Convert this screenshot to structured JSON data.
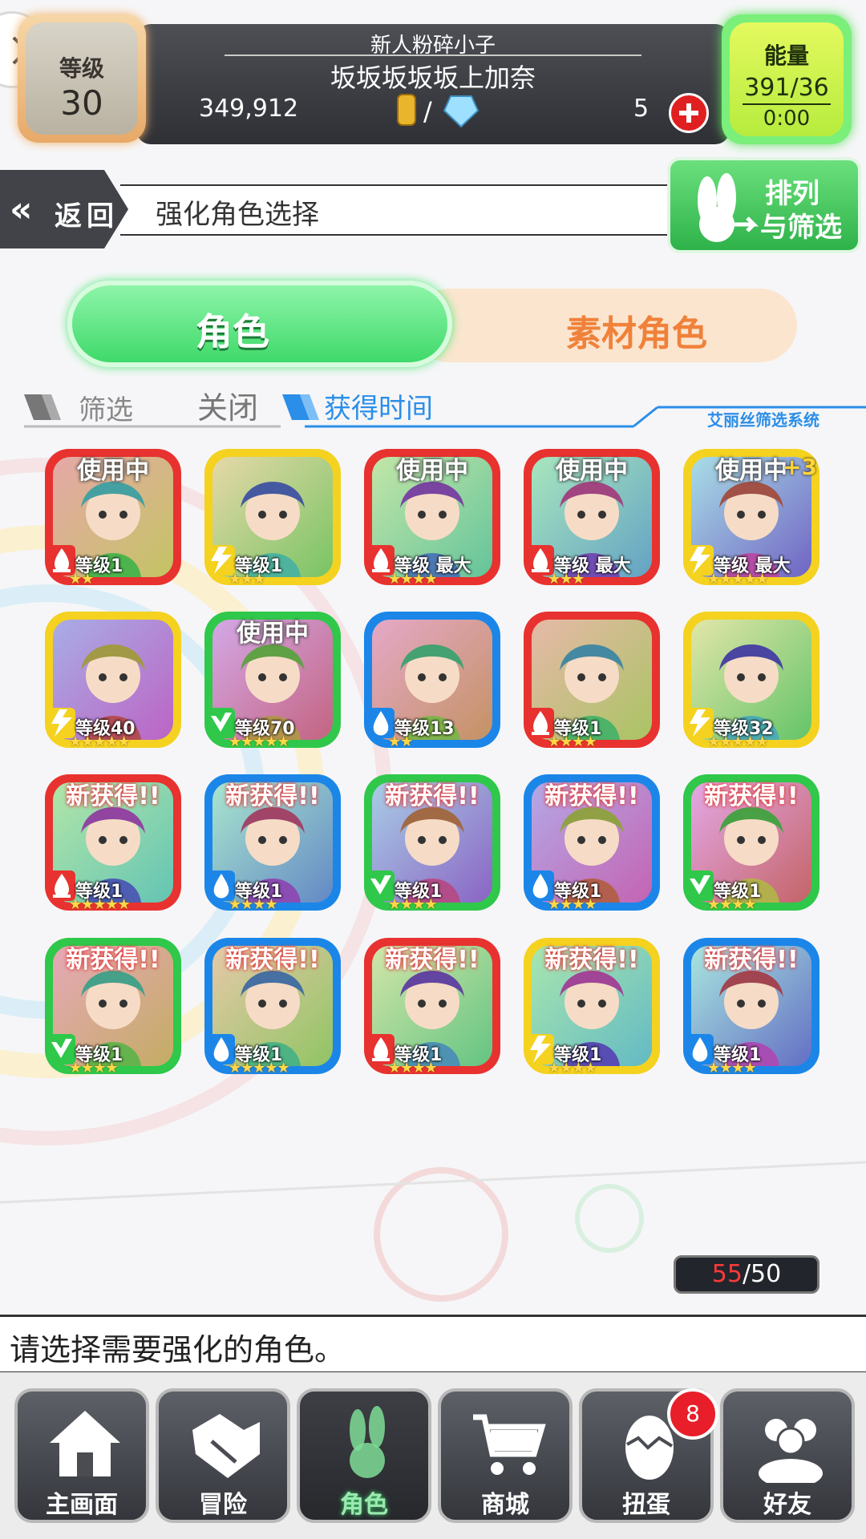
{
  "header": {
    "level_label": "等级",
    "level_value": "30",
    "player_title": "新人粉碎小子",
    "player_name": "坂坂坂坂坂上加奈",
    "coins": "349,912",
    "currency_separator": "/",
    "gems": "5",
    "energy_label": "能量",
    "energy_value": "391/36",
    "energy_timer": "0:00"
  },
  "nav_bar": {
    "back_label": "返回",
    "page_title": "强化角色选择",
    "sort_label_line1": "排列",
    "sort_label_line2": "与筛选"
  },
  "tabs": {
    "characters": "角色",
    "material": "素材角色"
  },
  "filter": {
    "filter_label": "筛选",
    "filter_value": "关闭",
    "sort_value": "获得时间",
    "system_label": "艾丽丝筛选系统"
  },
  "characters": [
    {
      "badge": "使用中",
      "level": "等级1",
      "element": "fire",
      "stars": "★★",
      "color": "#e8322f"
    },
    {
      "badge": "",
      "level": "等级1",
      "element": "thunder",
      "stars": "★★★",
      "color": "#f4d21f"
    },
    {
      "badge": "使用中",
      "level": "等级 最大",
      "element": "fire",
      "stars": "★★★★",
      "color": "#e8322f"
    },
    {
      "badge": "使用中",
      "level": "等级 最大",
      "element": "fire",
      "stars": "★★★",
      "color": "#e8322f"
    },
    {
      "badge": "使用中",
      "level": "等级 最大",
      "element": "thunder",
      "stars": "★★★★★",
      "color": "#f4d21f",
      "extra": "+3"
    },
    {
      "badge": "",
      "level": "等级40",
      "element": "thunder",
      "stars": "★★★★★",
      "color": "#f4d21f"
    },
    {
      "badge": "使用中",
      "level": "等级70",
      "element": "wind",
      "stars": "★★★★★",
      "color": "#2fc84a"
    },
    {
      "badge": "",
      "level": "等级13",
      "element": "water",
      "stars": "★★",
      "color": "#1b86e8"
    },
    {
      "badge": "",
      "level": "等级1",
      "element": "fire",
      "stars": "★★★★",
      "color": "#e8322f"
    },
    {
      "badge": "",
      "level": "等级32",
      "element": "thunder",
      "stars": "★★★★★",
      "color": "#f4d21f"
    },
    {
      "badge": "新获得!!",
      "level": "等级1",
      "element": "fire",
      "stars": "★★★★★",
      "color": "#e8322f"
    },
    {
      "badge": "新获得!!",
      "level": "等级1",
      "element": "water",
      "stars": "★★★★",
      "color": "#1b86e8"
    },
    {
      "badge": "新获得!!",
      "level": "等级1",
      "element": "wind",
      "stars": "★★★★",
      "color": "#2fc84a"
    },
    {
      "badge": "新获得!!",
      "level": "等级1",
      "element": "water",
      "stars": "★★★★",
      "color": "#1b86e8"
    },
    {
      "badge": "新获得!!",
      "level": "等级1",
      "element": "wind",
      "stars": "★★★★",
      "color": "#2fc84a"
    },
    {
      "badge": "新获得!!",
      "level": "等级1",
      "element": "wind",
      "stars": "★★★★",
      "color": "#2fc84a"
    },
    {
      "badge": "新获得!!",
      "level": "等级1",
      "element": "water",
      "stars": "★★★★★",
      "color": "#1b86e8"
    },
    {
      "badge": "新获得!!",
      "level": "等级1",
      "element": "fire",
      "stars": "★★★★",
      "color": "#e8322f"
    },
    {
      "badge": "新获得!!",
      "level": "等级1",
      "element": "thunder",
      "stars": "★★★★",
      "color": "#f4d21f"
    },
    {
      "badge": "新获得!!",
      "level": "等级1",
      "element": "water",
      "stars": "★★★★",
      "color": "#1b86e8"
    }
  ],
  "box_count": {
    "current": "55",
    "separator": "/",
    "max": "50"
  },
  "message": "请选择需要强化的角色。",
  "bottom_nav": [
    {
      "label": "主画面",
      "icon": "home-icon"
    },
    {
      "label": "冒险",
      "icon": "handshake-icon"
    },
    {
      "label": "角色",
      "icon": "bunny-icon",
      "active": true
    },
    {
      "label": "商城",
      "icon": "cart-icon"
    },
    {
      "label": "扭蛋",
      "icon": "egg-icon",
      "badge": "8"
    },
    {
      "label": "好友",
      "icon": "friends-icon"
    }
  ],
  "colors": {
    "fire": "#e8322f",
    "water": "#1b86e8",
    "wind": "#2fc84a",
    "thunder": "#f4d21f",
    "accent": "#3fd96a"
  }
}
